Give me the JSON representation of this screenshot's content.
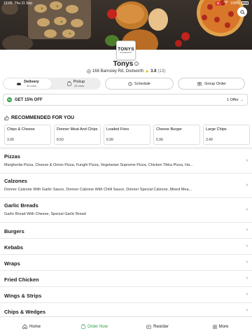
{
  "status_bar": {
    "time": "13:00",
    "date": "Thu 11 Sep",
    "battery": "100%"
  },
  "restaurant": {
    "logo_text": "TONYS",
    "logo_sub": "DODWORTH",
    "name": "Tonys",
    "address": "168 Barnsley Rd, Dodworth",
    "rating": "3.8",
    "rating_count": "(13)"
  },
  "mode": {
    "delivery": {
      "label": "Delivery",
      "time": "45 mins"
    },
    "pickup": {
      "label": "Pickup",
      "time": "15 mins"
    },
    "schedule_label": "Schedule",
    "group_label": "Group Order"
  },
  "offer": {
    "text": "GET 15% OFF",
    "count": "1 Offer"
  },
  "recommended": {
    "title": "RECOMMENDED FOR YOU",
    "items": [
      {
        "name": "Chips & Cheese",
        "price": "3.99"
      },
      {
        "name": "Donner Meat And Chips",
        "price": "8.50"
      },
      {
        "name": "Loaded Fries",
        "price": "6.99"
      },
      {
        "name": "Cheese Burger",
        "price": "5.99"
      },
      {
        "name": "Large Chips",
        "price": "3.49"
      }
    ]
  },
  "categories": [
    {
      "name": "Pizzas",
      "desc": "Margherita Pizza, Cheese & Onion Pizza, Funghi Pizza, Vegetarian Supreme Pizza, Chicken Tikka Pizza, Ha..."
    },
    {
      "name": "Calzones",
      "desc": "Donner Calzone With Garlic Sauce, Donner Calzone With Chilli Sauce, Donner Special Calzone, Mixed Mea..."
    },
    {
      "name": "Garlic Breads",
      "desc": "Garlic Bread With Cheese, Special Garlic Bread"
    },
    {
      "name": "Burgers",
      "desc": ""
    },
    {
      "name": "Kebabs",
      "desc": ""
    },
    {
      "name": "Wraps",
      "desc": ""
    },
    {
      "name": "Fried Chicken",
      "desc": ""
    },
    {
      "name": "Wings & Strips",
      "desc": ""
    },
    {
      "name": "Chips & Wedges",
      "desc": ""
    }
  ],
  "tabs": {
    "home": "Home",
    "order_now": "Order Now",
    "reorder": "Reorder",
    "more": "More"
  },
  "colors": {
    "accent": "#2e9e43",
    "star": "#f4b400",
    "record": "#e53935"
  }
}
